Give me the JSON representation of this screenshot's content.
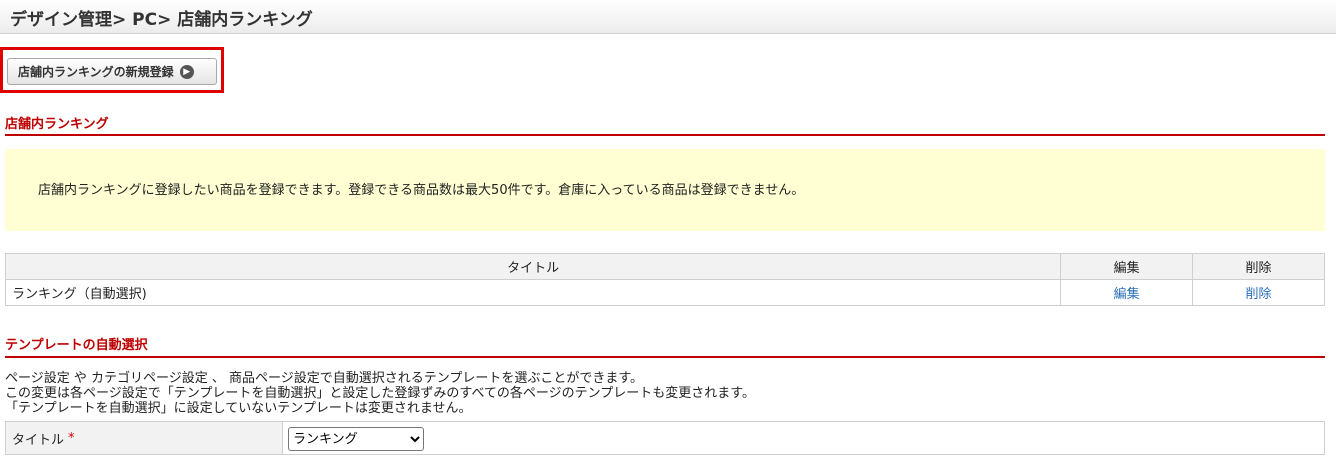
{
  "header": {
    "title": "デザイン管理> PC> 店舗内ランキング"
  },
  "toolbar": {
    "new_button_label": "店舗内ランキングの新規登録"
  },
  "section1": {
    "title": "店舗内ランキング",
    "notice": "店舗内ランキングに登録したい商品を登録できます。登録できる商品数は最大50件です。倉庫に入っている商品は登録できません。"
  },
  "table": {
    "headers": [
      "タイトル",
      "編集",
      "削除"
    ],
    "rows": [
      {
        "title": "ランキング（自動選択)",
        "edit": "編集",
        "delete": "削除"
      }
    ]
  },
  "section2": {
    "title": "テンプレートの自動選択",
    "lines": [
      "ページ設定 や カテゴリページ設定 、 商品ページ設定で自動選択されるテンプレートを選ぶことができます。",
      "この変更は各ページ設定で「テンプレートを自動選択」と設定した登録ずみのすべての各ページのテンプレートも変更されます。",
      "「テンプレートを自動選択」に設定していないテンプレートは変更されません。"
    ],
    "form": {
      "label": "タイトル",
      "required_mark": "*",
      "selected": "ランキング"
    }
  },
  "colors": {
    "accent": "#c00000",
    "highlight_border": "#e00000",
    "notice_bg": "#ffffd3",
    "link": "#2a6fb5"
  }
}
